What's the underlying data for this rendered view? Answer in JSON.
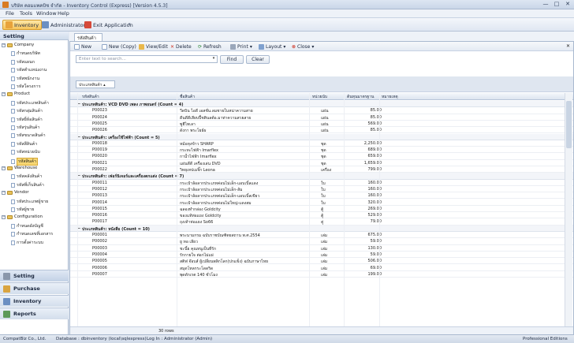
{
  "window": {
    "title": "บริษัท คอมแพคบิซ จำกัด - Inventory Control (Express) [Version 4.5.3]",
    "minimize": "—",
    "maximize": "□",
    "close": "✕"
  },
  "menu": [
    "File",
    "Tools",
    "Window",
    "Help"
  ],
  "toolbar": {
    "inventory": "Inventory",
    "administrator": "Administrator",
    "exit": "Exit Application"
  },
  "sidebar": {
    "header": "Setting",
    "tree": [
      {
        "label": "Company",
        "level": 0,
        "type": "folder"
      },
      {
        "label": "กำหนดบริษัท",
        "level": 1,
        "type": "doc"
      },
      {
        "label": "รหัสแผนก",
        "level": 1,
        "type": "doc"
      },
      {
        "label": "รหัสตำแหน่งงาน",
        "level": 1,
        "type": "doc"
      },
      {
        "label": "รหัสพนักงาน",
        "level": 1,
        "type": "doc"
      },
      {
        "label": "รหัสโครงการ",
        "level": 1,
        "type": "doc"
      },
      {
        "label": "Product",
        "level": 0,
        "type": "folder"
      },
      {
        "label": "รหัสประเภทสินค้า",
        "level": 1,
        "type": "doc"
      },
      {
        "label": "รหัสกลุ่มสินค้า",
        "level": 1,
        "type": "doc"
      },
      {
        "label": "รหัสยี่ห้อสินค้า",
        "level": 1,
        "type": "doc"
      },
      {
        "label": "รหัสรุ่นสินค้า",
        "level": 1,
        "type": "doc"
      },
      {
        "label": "รหัสขนาดสินค้า",
        "level": 1,
        "type": "doc"
      },
      {
        "label": "รหัสสีสินค้า",
        "level": 1,
        "type": "doc"
      },
      {
        "label": "รหัสหน่วยนับ",
        "level": 1,
        "type": "doc"
      },
      {
        "label": "รหัสสินค้า",
        "level": 1,
        "type": "doc",
        "selected": true
      },
      {
        "label": "Warehouse",
        "level": 0,
        "type": "folder"
      },
      {
        "label": "รหัสคลังสินค้า",
        "level": 1,
        "type": "doc"
      },
      {
        "label": "รหัสที่เก็บสินค้า",
        "level": 1,
        "type": "doc"
      },
      {
        "label": "Vendor",
        "level": 0,
        "type": "folder"
      },
      {
        "label": "รหัสประเภทผู้ขาย",
        "level": 1,
        "type": "doc"
      },
      {
        "label": "รหัสผู้ขาย",
        "level": 1,
        "type": "doc"
      },
      {
        "label": "Configuration",
        "level": 0,
        "type": "folder"
      },
      {
        "label": "กำหนดผังบัญชี",
        "level": 1,
        "type": "doc"
      },
      {
        "label": "กำหนดเลขที่เอกสาร",
        "level": 1,
        "type": "doc"
      },
      {
        "label": "การตั้งค่าระบบ",
        "level": 1,
        "type": "doc"
      }
    ],
    "nav": [
      "Setting",
      "Purchase",
      "Inventory",
      "Reports"
    ]
  },
  "tab": {
    "label": "รหัสสินค้า"
  },
  "grid_toolbar": {
    "new": "New",
    "new_copy": "New (Copy)",
    "view_edit": "View/Edit",
    "delete": "Delete",
    "refresh": "Refresh",
    "print": "Print",
    "layout": "Layout",
    "close": "Close"
  },
  "search": {
    "placeholder": "Enter text to search...",
    "find": "Find",
    "clear": "Clear"
  },
  "group_by": "ประเภทสินค้า",
  "columns": [
    "รหัสสินค้า",
    "ชื่อสินค้า",
    "หน่วยนับ",
    "ต้นทุนมาตรฐาน",
    "หมายเหตุ"
  ],
  "groups": [
    {
      "title": "ประเภทสินค้า: VCD DVD เพลง ภาพยนตร์ (Count = 4)",
      "rows": [
        [
          "P00023",
          "วีดบิน ไอดี เอสชั่น.ลมชายในหน่าความสาย",
          "แผ่น",
          "85.00"
        ],
        [
          "P00024",
          "ดีนดีดีเสียบปี้ชตินลต้อ.มาท่าความสวยสาย",
          "แผ่น",
          "85.00"
        ],
        [
          "P00025",
          "ซูฮีไทเลา",
          "แผ่น",
          "569.00"
        ],
        [
          "P00026",
          "ดังกา พระโยธ์ผ",
          "แผ่น",
          "85.00"
        ]
      ]
    },
    {
      "title": "ประเภทสินค้า: เครื่องใช้ไฟฟ้า (Count = 5)",
      "rows": [
        [
          "P00018",
          "หม้อหุงข้าว SHARP",
          "ชุด",
          "2,250.00"
        ],
        [
          "P00019",
          "กระทะไฟฟ้า Imarflex",
          "ชุด",
          "689.00"
        ],
        [
          "P00020",
          "กาน้ำไฟฟ้า Imarflex",
          "ชุด",
          "659.00"
        ],
        [
          "P00021",
          "แผ่นดีดี เครื่องเล่น DVD",
          "ชุด",
          "1,659.00"
        ],
        [
          "P00022",
          "วิทยุเทปเมจิ๊ก Leona",
          "เครื่อง",
          "799.00"
        ]
      ]
    },
    {
      "title": "ประเภทสินค้า: เฟอร์นิเจอร์และเครื่องตกแต่ง (Count = 7)",
      "rows": [
        [
          "P00011",
          "กระเป๋าล้อลากประเภทค่อนไม่เล็ก-แอบเบิ้ลแดง",
          "ใบ",
          "160.00"
        ],
        [
          "P00012",
          "กระเป๋าล้อลากประเภทค่อนไม่เล็ก-ส้ม",
          "ใบ",
          "160.00"
        ],
        [
          "P00013",
          "กระเป๋าล้อลากประเภทค่อนไม่เล็ก-แอบเบิ้ลเขียว",
          "ใบ",
          "160.00"
        ],
        [
          "P00014",
          "กระเป๋าล้อลากประเภทค่อนไม่ใหญ่-แดงสม",
          "ใบ",
          "320.00"
        ],
        [
          "P00015",
          "ฉลองทำกล่อง Goldcity",
          "ตู้",
          "269.00"
        ],
        [
          "P00016",
          "ของแท้ท่อแยง Goldcity",
          "ตู้",
          "529.00"
        ],
        [
          "P00017",
          "ถุงเท้าห่อแยง So66",
          "คู่",
          "79.00"
        ]
      ]
    },
    {
      "title": "ประเภทสินค้า: หนังสือ (Count = 10)",
      "rows": [
        [
          "P00001",
          "พระนามกรม ฉบับราชบัณฑิตยสถาน พ.ศ.2554",
          "เล่ม",
          "675.00"
        ],
        [
          "P00002",
          "ยู ทอ เลียว",
          "เล่ม",
          "59.00"
        ],
        [
          "P00003",
          "ชะนี้ย คุณหนูเป็นที่รัก",
          "เล่ม",
          "130.00"
        ],
        [
          "P00004",
          "รักกายใจ ต่อกไม่แผ่",
          "เล่ม",
          "59.00"
        ],
        [
          "P00005",
          "สติฟ จ๊อบส์ ผู้เปลี่ยนพลิกโลก(ปกแข็ง) ฉบับภาษาไทย",
          "เล่ม",
          "506.00"
        ],
        [
          "P00006",
          "สมุดโหลกระโดดริด",
          "เล่ม",
          "69.00"
        ],
        [
          "P00007",
          "พุดดักเรต 140 ชั่วโมง",
          "เล่ม",
          "199.00"
        ]
      ]
    }
  ],
  "footer": {
    "row_count": "30 rows"
  },
  "status": {
    "company": "CompatBiz Co., Ltd.",
    "database": "Database : dbinventory (local\\sqlexpress)",
    "login": "Log In : Administrator (Admin)",
    "edition": "Professional Editions"
  }
}
